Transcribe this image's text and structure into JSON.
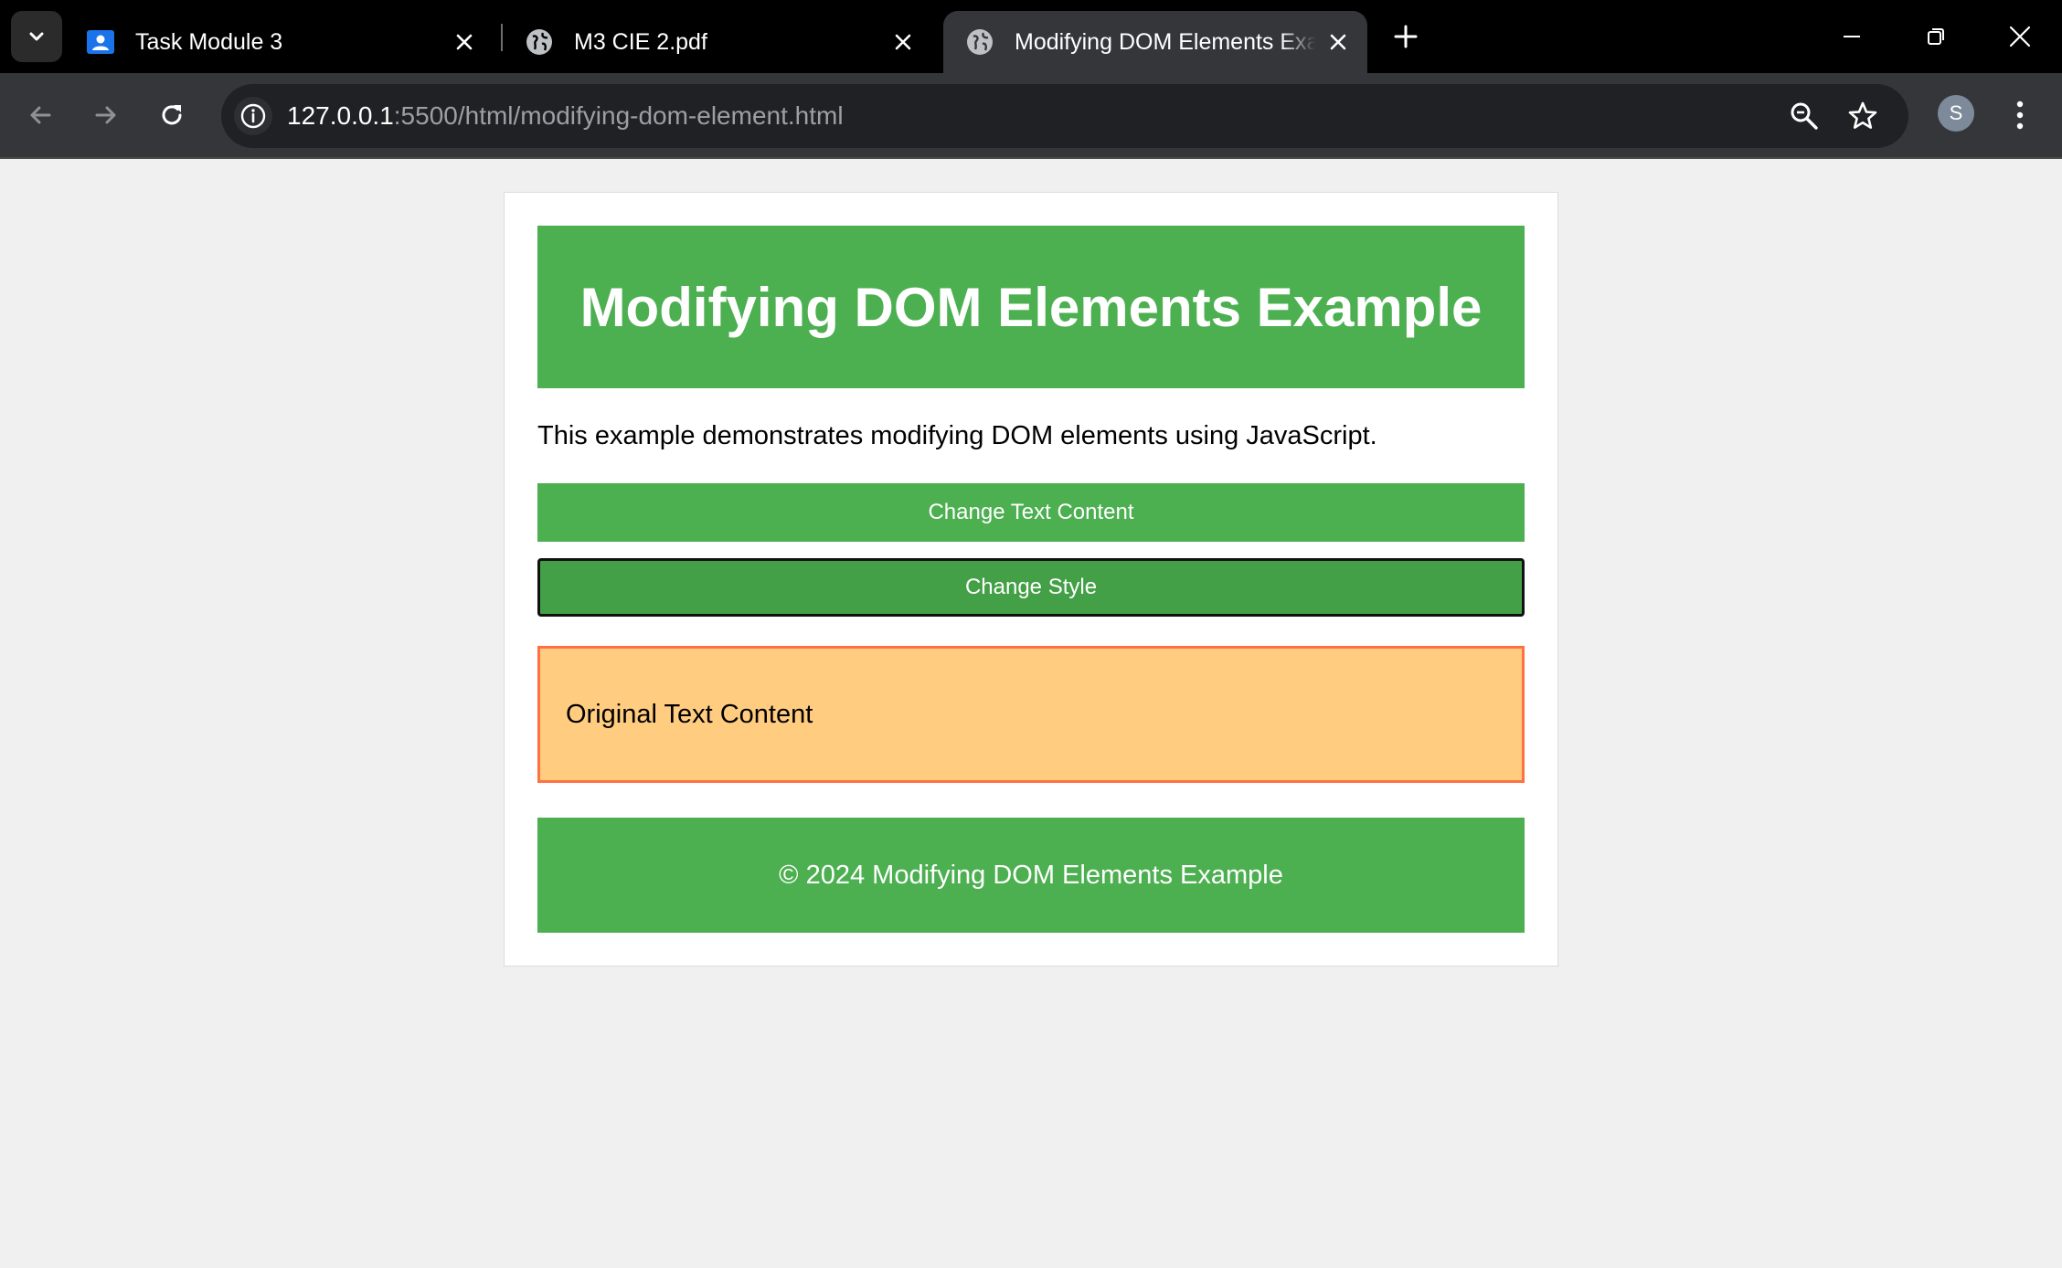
{
  "browser": {
    "tabs": [
      {
        "title": "Task Module 3",
        "favicon": "classroom-icon",
        "active": false
      },
      {
        "title": "M3 CIE 2.pdf",
        "favicon": "globe-icon",
        "active": false
      },
      {
        "title": "Modifying DOM Elements Example",
        "favicon": "globe-icon",
        "active": true
      }
    ],
    "address": {
      "host": "127.0.0.1",
      "rest": ":5500/html/modifying-dom-element.html"
    },
    "profile_initial": "S"
  },
  "page": {
    "heading": "Modifying DOM Elements Example",
    "intro": "This example demonstrates modifying DOM elements using JavaScript.",
    "buttons": {
      "change_text": "Change Text Content",
      "change_style": "Change Style"
    },
    "target_text": "Original Text Content",
    "footer": "© 2024 Modifying DOM Elements Example"
  },
  "colors": {
    "accent_green": "#4caf50",
    "target_bg": "#ffcc80",
    "target_border": "#ff7043"
  }
}
